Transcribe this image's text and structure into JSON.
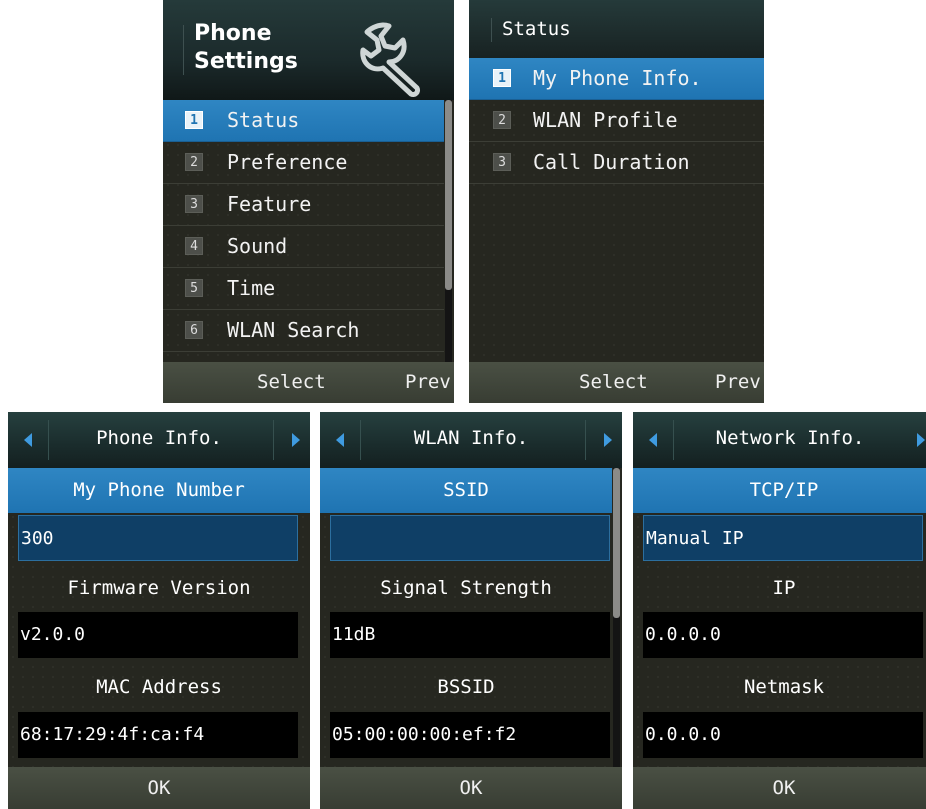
{
  "main_menu": {
    "title": "Phone\nSettings",
    "icon": "wrench-icon",
    "items": [
      {
        "num": "1",
        "label": "Status",
        "selected": true
      },
      {
        "num": "2",
        "label": "Preference",
        "selected": false
      },
      {
        "num": "3",
        "label": "Feature",
        "selected": false
      },
      {
        "num": "4",
        "label": "Sound",
        "selected": false
      },
      {
        "num": "5",
        "label": "Time",
        "selected": false
      },
      {
        "num": "6",
        "label": "WLAN Search",
        "selected": false
      }
    ],
    "softkeys": {
      "left": "Select",
      "right": "Prev"
    }
  },
  "status_menu": {
    "title": "Status",
    "items": [
      {
        "num": "1",
        "label": "My Phone Info.",
        "selected": true
      },
      {
        "num": "2",
        "label": "WLAN Profile",
        "selected": false
      },
      {
        "num": "3",
        "label": "Call Duration",
        "selected": false
      }
    ],
    "softkeys": {
      "left": "Select",
      "right": "Prev"
    }
  },
  "phone_info": {
    "title": "Phone Info.",
    "fields": [
      {
        "label": "My Phone Number",
        "value": "300"
      },
      {
        "label": "Firmware Version",
        "value": "v2.0.0"
      },
      {
        "label": "MAC Address",
        "value": "68:17:29:4f:ca:f4"
      }
    ],
    "ok": "OK"
  },
  "wlan_info": {
    "title": "WLAN Info.",
    "fields": [
      {
        "label": "SSID",
        "value": ""
      },
      {
        "label": "Signal Strength",
        "value": "11dB"
      },
      {
        "label": "BSSID",
        "value": "05:00:00:00:ef:f2"
      }
    ],
    "ok": "OK"
  },
  "network_info": {
    "title": "Network Info.",
    "fields": [
      {
        "label": "TCP/IP",
        "value": "Manual IP"
      },
      {
        "label": "IP",
        "value": "0.0.0.0"
      },
      {
        "label": "Netmask",
        "value": "0.0.0.0"
      }
    ],
    "ok": "OK"
  },
  "colors": {
    "accent": "#1f74b2",
    "background": "#262720",
    "softkey": "#3f443a",
    "arrow": "#3f9be0"
  }
}
